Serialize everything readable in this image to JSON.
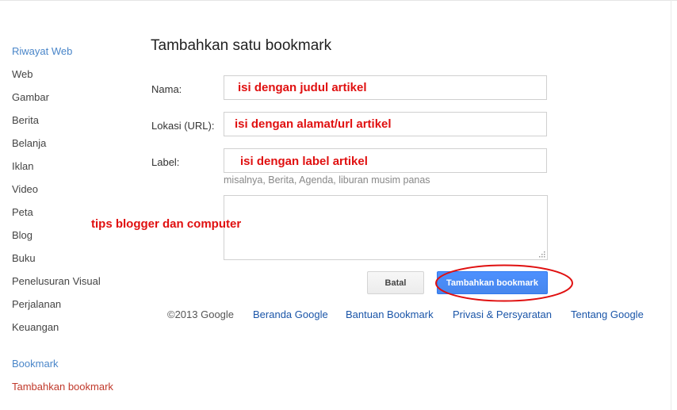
{
  "sidebar": {
    "items": [
      {
        "label": "Riwayat Web"
      },
      {
        "label": "Web"
      },
      {
        "label": "Gambar"
      },
      {
        "label": "Berita"
      },
      {
        "label": "Belanja"
      },
      {
        "label": "Iklan"
      },
      {
        "label": "Video"
      },
      {
        "label": "Peta"
      },
      {
        "label": "Blog"
      },
      {
        "label": "Buku"
      },
      {
        "label": "Penelusuran Visual"
      },
      {
        "label": "Perjalanan"
      },
      {
        "label": "Keuangan"
      }
    ],
    "bookmark": "Bookmark",
    "add_bookmark": "Tambahkan bookmark"
  },
  "main": {
    "title": "Tambahkan satu bookmark",
    "form": {
      "name_label": "Nama:",
      "name_value": "isi dengan judul artikel",
      "url_label": "Lokasi (URL):",
      "url_value": "isi dengan alamat/url artikel",
      "label_label": "Label:",
      "label_value": "isi dengan label artikel",
      "label_hint": "misalnya, Berita, Agenda, liburan musim panas"
    },
    "annotation": "tips blogger dan computer",
    "buttons": {
      "cancel": "Batal",
      "submit": "Tambahkan bookmark"
    },
    "highlight_color": "#e01010"
  },
  "footer": {
    "copyright": "©2013 Google",
    "links": [
      "Beranda Google",
      "Bantuan Bookmark",
      "Privasi & Persyaratan",
      "Tentang Google"
    ]
  }
}
